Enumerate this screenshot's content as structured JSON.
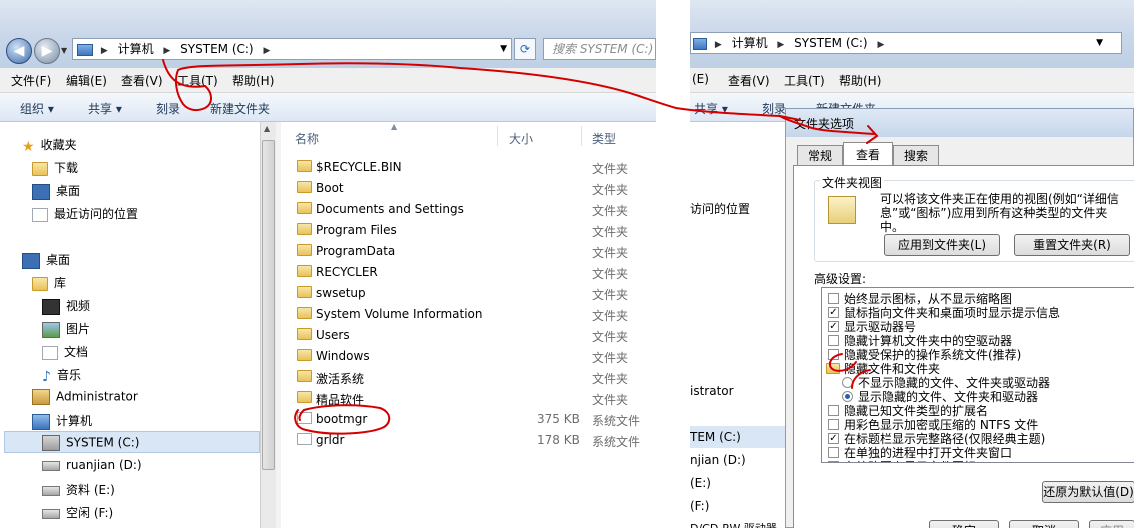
{
  "left": {
    "address": {
      "parts": [
        "计算机",
        "SYSTEM (C:)"
      ]
    },
    "search_placeholder": "搜索 SYSTEM (C:)",
    "menu": [
      "文件(F)",
      "编辑(E)",
      "查看(V)",
      "工具(T)",
      "帮助(H)"
    ],
    "commands": [
      "组织 ▾",
      "共享 ▾",
      "刻录",
      "新建文件夹"
    ],
    "nav": [
      {
        "label": "收藏夹",
        "icon": "star-icon"
      },
      {
        "label": "下载",
        "icon": "download-folder-icon"
      },
      {
        "label": "桌面",
        "icon": "desktop-icon"
      },
      {
        "label": "最近访问的位置",
        "icon": "recent-places-icon"
      },
      {
        "label": "桌面",
        "icon": "desktop-icon"
      },
      {
        "label": "库",
        "icon": "library-icon"
      },
      {
        "label": "视频",
        "icon": "video-icon"
      },
      {
        "label": "图片",
        "icon": "picture-icon"
      },
      {
        "label": "文档",
        "icon": "document-icon"
      },
      {
        "label": "音乐",
        "icon": "music-icon"
      },
      {
        "label": "Administrator",
        "icon": "user-icon"
      },
      {
        "label": "计算机",
        "icon": "computer-icon"
      },
      {
        "label": "SYSTEM (C:)",
        "icon": "system-drive-icon"
      },
      {
        "label": "ruanjian (D:)",
        "icon": "drive-icon"
      },
      {
        "label": "资料 (E:)",
        "icon": "drive-icon"
      },
      {
        "label": "空闲 (F:)",
        "icon": "drive-icon"
      }
    ],
    "columns": {
      "name": "名称",
      "size": "大小",
      "type": "类型"
    },
    "files": [
      {
        "name": "$RECYCLE.BIN",
        "size": "",
        "type": "文件夹",
        "kind": "folder"
      },
      {
        "name": "Boot",
        "size": "",
        "type": "文件夹",
        "kind": "folder"
      },
      {
        "name": "Documents and Settings",
        "size": "",
        "type": "文件夹",
        "kind": "folder"
      },
      {
        "name": "Program Files",
        "size": "",
        "type": "文件夹",
        "kind": "folder"
      },
      {
        "name": "ProgramData",
        "size": "",
        "type": "文件夹",
        "kind": "folder"
      },
      {
        "name": "RECYCLER",
        "size": "",
        "type": "文件夹",
        "kind": "folder"
      },
      {
        "name": "swsetup",
        "size": "",
        "type": "文件夹",
        "kind": "folder"
      },
      {
        "name": "System Volume Information",
        "size": "",
        "type": "文件夹",
        "kind": "locked-folder"
      },
      {
        "name": "Users",
        "size": "",
        "type": "文件夹",
        "kind": "folder"
      },
      {
        "name": "Windows",
        "size": "",
        "type": "文件夹",
        "kind": "folder"
      },
      {
        "name": "激活系统",
        "size": "",
        "type": "文件夹",
        "kind": "folder"
      },
      {
        "name": "精品软件",
        "size": "",
        "type": "文件夹",
        "kind": "folder"
      },
      {
        "name": "bootmgr",
        "size": "375 KB",
        "type": "系统文件",
        "kind": "file"
      },
      {
        "name": "grldr",
        "size": "178 KB",
        "type": "系统文件",
        "kind": "file"
      }
    ]
  },
  "right": {
    "address": {
      "parts": [
        "计算机",
        "SYSTEM (C:)"
      ]
    },
    "menu": [
      "(E)",
      "查看(V)",
      "工具(T)",
      "帮助(H)"
    ],
    "commands": [
      "共享 ▾",
      "刻录",
      "新建文件夹"
    ],
    "nav_partial": [
      "访问的位置",
      "istrator",
      "TEM (C:)",
      "njian (D:)",
      "(E:)",
      "(F:)",
      "D/CD-RW 驱动器"
    ],
    "dialog": {
      "title": "文件夹选项",
      "tabs": [
        "常规",
        "查看",
        "搜索"
      ],
      "active_tab": "查看",
      "folder_view_title": "文件夹视图",
      "folder_view_text": [
        "可以将该文件夹正在使用的视图(例如“详细信",
        "息”或“图标”)应用到所有这种类型的文件夹",
        "中。"
      ],
      "apply_button": "应用到文件夹(L)",
      "reset_button": "重置文件夹(R)",
      "advanced_title": "高级设置:",
      "options": [
        {
          "kind": "checkbox",
          "checked": false,
          "label": "始终显示图标，从不显示缩略图"
        },
        {
          "kind": "checkbox",
          "checked": true,
          "label": "鼠标指向文件夹和桌面项时显示提示信息"
        },
        {
          "kind": "checkbox",
          "checked": true,
          "label": "显示驱动器号"
        },
        {
          "kind": "checkbox",
          "checked": false,
          "label": "隐藏计算机文件夹中的空驱动器"
        },
        {
          "kind": "checkbox",
          "checked": false,
          "label": "隐藏受保护的操作系统文件(推荐)"
        },
        {
          "kind": "folder",
          "checked": false,
          "label": "隐藏文件和文件夹"
        },
        {
          "kind": "radio",
          "checked": false,
          "label": "不显示隐藏的文件、文件夹或驱动器"
        },
        {
          "kind": "radio",
          "checked": true,
          "label": "显示隐藏的文件、文件夹和驱动器"
        },
        {
          "kind": "checkbox",
          "checked": false,
          "label": "隐藏已知文件类型的扩展名"
        },
        {
          "kind": "checkbox",
          "checked": false,
          "label": "用彩色显示加密或压缩的 NTFS 文件"
        },
        {
          "kind": "checkbox",
          "checked": true,
          "label": "在标题栏显示完整路径(仅限经典主题)"
        },
        {
          "kind": "checkbox",
          "checked": false,
          "label": "在单独的进程中打开文件夹窗口"
        },
        {
          "kind": "checkbox",
          "checked": true,
          "label": "在缩略图上显示文件图标"
        }
      ],
      "restore_button": "还原为默认值(D)",
      "ok_button": "确定",
      "cancel_button": "取消",
      "apply_bottom": "应用"
    }
  },
  "colors": {
    "annotation": "#d40000",
    "accent": "#1e395b"
  }
}
